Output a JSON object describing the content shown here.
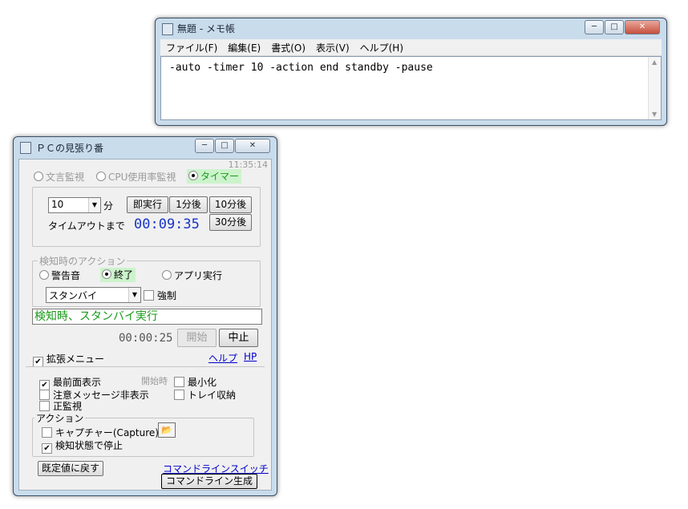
{
  "notepad": {
    "title": "無題 - メモ帳",
    "menu": [
      "ファイル(F)",
      "編集(E)",
      "書式(O)",
      "表示(V)",
      "ヘルプ(H)"
    ],
    "content": "-auto -timer 10 -action end standby -pause",
    "controls": {
      "minimize": "─",
      "maximize": "□",
      "close": "✕"
    }
  },
  "app": {
    "title": "ＰＣの見張り番",
    "clock": "11:35:14",
    "modes": [
      "文言監視",
      "CPU使用率監視",
      "タイマー"
    ],
    "selected_mode": "タイマー",
    "timer": {
      "minutes_value": "10",
      "minutes_unit": "分",
      "buttons": [
        "即実行",
        "1分後",
        "10分後",
        "30分後"
      ],
      "timeout_label": "タイムアウトまで",
      "timeout_value": "00:09:35"
    },
    "detect_action": {
      "group_label": "検知時のアクション",
      "options": [
        "警告音",
        "終了",
        "アプリ実行"
      ],
      "selected": "終了",
      "action_select": "スタンバイ",
      "force_label": "強制"
    },
    "status_message": "検知時、スタンバイ実行",
    "elapsed": "00:00:25",
    "start_button": "開始",
    "stop_button": "中止",
    "extended_menu_label": "拡張メニュー",
    "help_link": "ヘルプ",
    "hp_link": "HP",
    "options": {
      "topmost": "最前面表示",
      "hide_warning": "注意メッセージ非表示",
      "regex": "正監視",
      "on_start_label": "開始時",
      "minimize": "最小化",
      "tray": "トレイ収納"
    },
    "action_group": {
      "label": "アクション",
      "capture": "キャプチャー(Capture)",
      "stop_on_detect": "検知状態で停止"
    },
    "reset_button": "既定値に戻す",
    "cmdline_link": "コマンドラインスイッチ",
    "cmdline_button": "コマンドライン生成"
  },
  "colors": {
    "timer_blue": "#1633c8",
    "status_green": "#1a9a1a",
    "highlight_green": "#ccf3cc"
  }
}
